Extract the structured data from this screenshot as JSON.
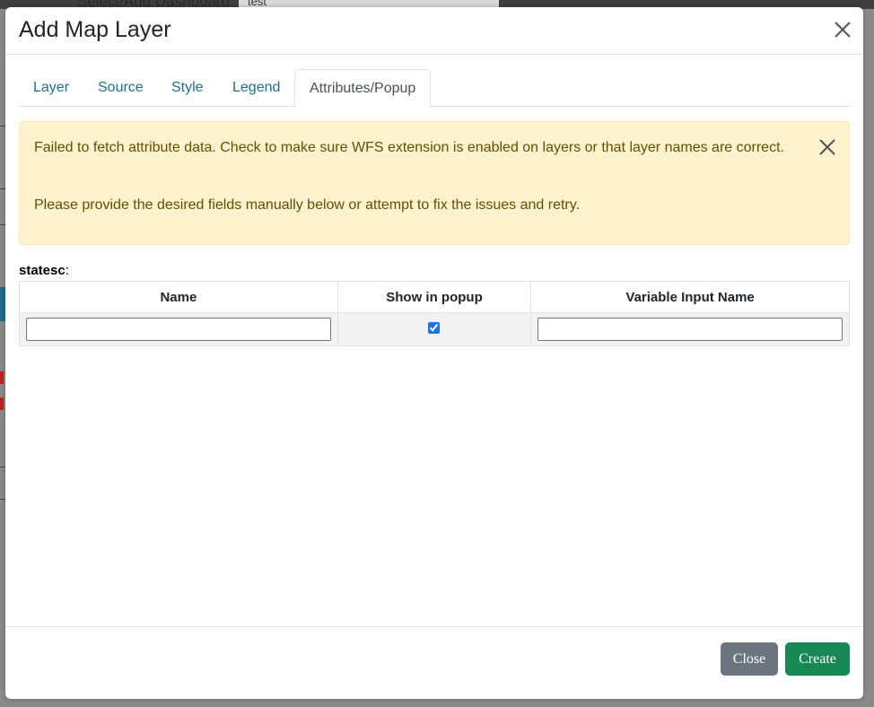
{
  "background": {
    "dashboard_label": "Select/Add Dashboard:",
    "dashboard_value": "test"
  },
  "modal": {
    "title": "Add Map Layer",
    "tabs": [
      {
        "label": "Layer"
      },
      {
        "label": "Source"
      },
      {
        "label": "Style"
      },
      {
        "label": "Legend"
      },
      {
        "label": "Attributes/Popup",
        "active": true
      }
    ],
    "alert": {
      "message": "Failed to fetch attribute data. Check to make sure WFS extension is enabled on layers or that layer names are correct.",
      "message2": "Please provide the desired fields manually below or attempt to fix the issues and retry.",
      "color": "#fff3cd"
    },
    "layer_name": "statesc",
    "layer_suffix": ":",
    "table": {
      "headers": [
        "Name",
        "Show in popup",
        "Variable Input Name"
      ],
      "rows": [
        {
          "name": "",
          "show_in_popup": true,
          "variable_input_name": ""
        }
      ]
    },
    "footer": {
      "close_label": "Close",
      "create_label": "Create",
      "close_color": "#6c757d",
      "create_color": "#198754"
    }
  }
}
